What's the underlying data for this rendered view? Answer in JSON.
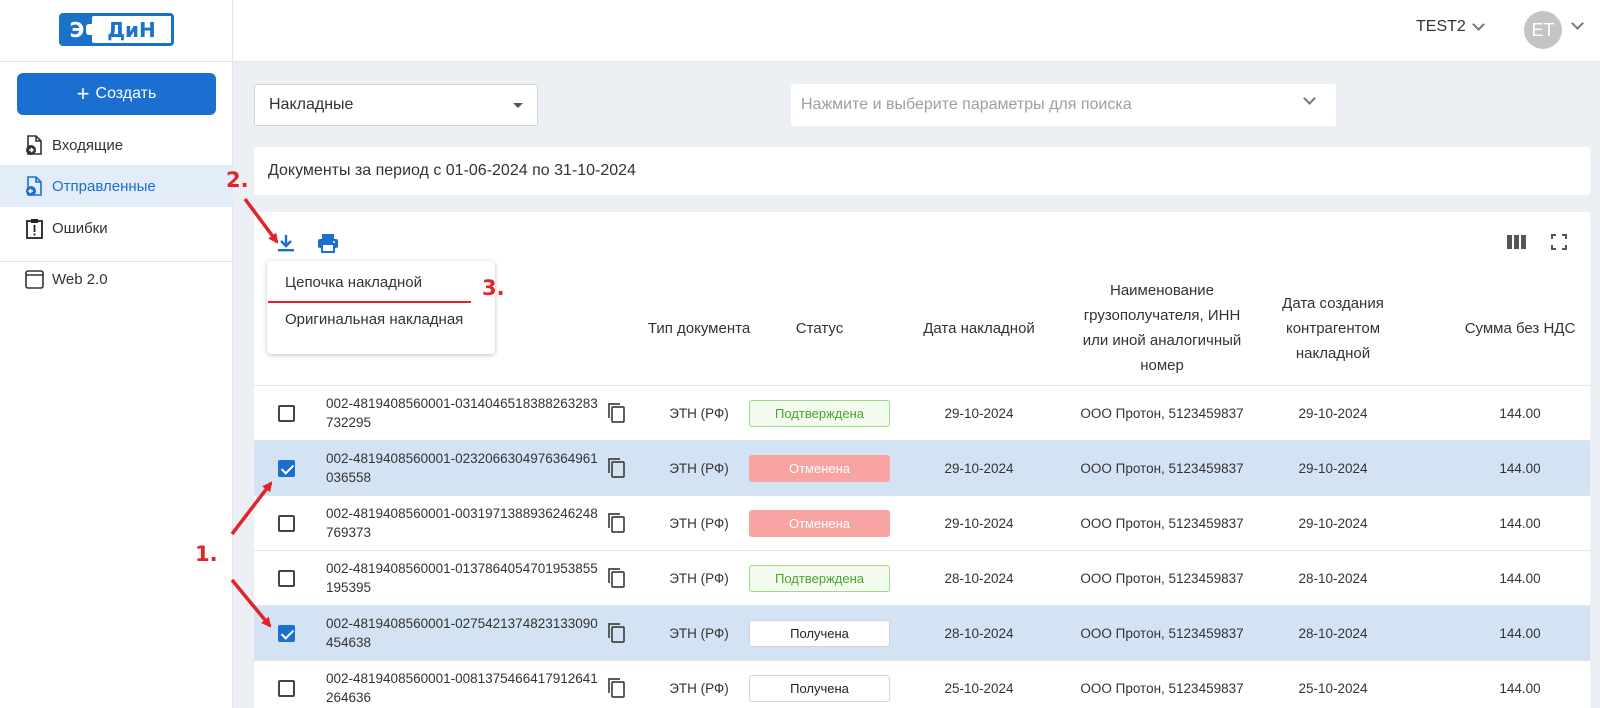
{
  "header": {
    "logo_left": "Э",
    "logo_right": "ДиН",
    "account": "TEST2",
    "avatar_initials": "ET"
  },
  "sidebar": {
    "create_label": "Создать",
    "items": [
      {
        "label": "Входящие",
        "icon": "incoming-doc-icon"
      },
      {
        "label": "Отправленные",
        "icon": "outgoing-doc-icon",
        "active": true
      },
      {
        "label": "Ошибки",
        "icon": "error-clipboard-icon"
      },
      {
        "label": "Web 2.0",
        "icon": "window-icon"
      }
    ]
  },
  "filters": {
    "doc_type": "Накладные",
    "search_placeholder": "Нажмите и выберите параметры для поиска"
  },
  "period_text": "Документы за период с 01-06-2024 по 31-10-2024",
  "menu": {
    "items": [
      "Цепочка накладной",
      "Оригинальная накладная"
    ]
  },
  "annotations": [
    "1.",
    "2.",
    "3."
  ],
  "table": {
    "columns": [
      "Тип документа",
      "Статус",
      "Дата накладной",
      "Наименование грузополучателя, ИНН или иной аналогичный номер",
      "Дата создания контрагентом накладной",
      "Сумма без НДС"
    ],
    "rows": [
      {
        "number": "002-4819408560001-0314046518388263283732295",
        "type": "ЭТН (РФ)",
        "status": "Подтверждена",
        "status_kind": "ok",
        "date": "29-10-2024",
        "consignee": "ООО Протон, 5123459837",
        "created": "29-10-2024",
        "sum": "144.00",
        "checked": false
      },
      {
        "number": "002-4819408560001-0232066304976364961036558",
        "type": "ЭТН (РФ)",
        "status": "Отменена",
        "status_kind": "cancel",
        "date": "29-10-2024",
        "consignee": "ООО Протон, 5123459837",
        "created": "29-10-2024",
        "sum": "144.00",
        "checked": true
      },
      {
        "number": "002-4819408560001-0031971388936246248769373",
        "type": "ЭТН (РФ)",
        "status": "Отменена",
        "status_kind": "cancel",
        "date": "29-10-2024",
        "consignee": "ООО Протон, 5123459837",
        "created": "29-10-2024",
        "sum": "144.00",
        "checked": false
      },
      {
        "number": "002-4819408560001-0137864054701953855195395",
        "type": "ЭТН (РФ)",
        "status": "Подтверждена",
        "status_kind": "ok",
        "date": "28-10-2024",
        "consignee": "ООО Протон, 5123459837",
        "created": "28-10-2024",
        "sum": "144.00",
        "checked": false
      },
      {
        "number": "002-4819408560001-0275421374823133090454638",
        "type": "ЭТН (РФ)",
        "status": "Получена",
        "status_kind": "recv",
        "date": "28-10-2024",
        "consignee": "ООО Протон, 5123459837",
        "created": "28-10-2024",
        "sum": "144.00",
        "checked": true
      },
      {
        "number": "002-4819408560001-0081375466417912641264636",
        "type": "ЭТН (РФ)",
        "status": "Получена",
        "status_kind": "recv",
        "date": "25-10-2024",
        "consignee": "ООО Протон, 5123459837",
        "created": "25-10-2024",
        "sum": "144.00",
        "checked": false
      }
    ]
  }
}
